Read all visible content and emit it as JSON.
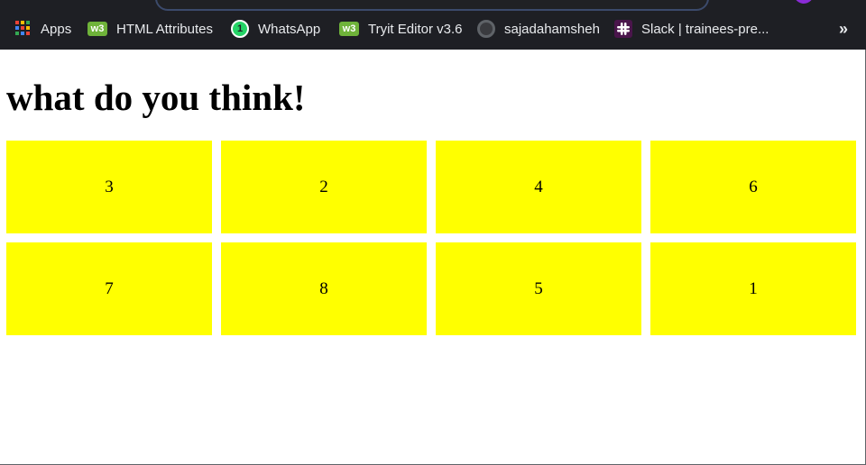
{
  "browser": {
    "bookmarks": [
      {
        "label": "Apps",
        "icon": "apps-grid-icon"
      },
      {
        "label": "HTML Attributes",
        "icon": "w3schools-icon",
        "icon_text": "w3"
      },
      {
        "label": "WhatsApp",
        "icon": "whatsapp-icon",
        "icon_text": "1"
      },
      {
        "label": "Tryit Editor v3.6",
        "icon": "w3schools-icon",
        "icon_text": "w3"
      },
      {
        "label": "sajadahamsheh",
        "icon": "github-icon"
      },
      {
        "label": "Slack | trainees-pre...",
        "icon": "slack-icon"
      }
    ],
    "overflow_label": "»",
    "colors": {
      "toolbar_bg": "#1e1f24",
      "text": "#e8eaed",
      "w3_green": "#6fb33a",
      "whatsapp_green": "#25d366",
      "slack_purple": "#4a154b"
    }
  },
  "page": {
    "heading": "what do you think!",
    "tiles": [
      "3",
      "2",
      "4",
      "6",
      "7",
      "8",
      "5",
      "1"
    ],
    "colors": {
      "tile_bg": "#ffff00",
      "text": "#000000",
      "page_bg": "#ffffff"
    }
  }
}
